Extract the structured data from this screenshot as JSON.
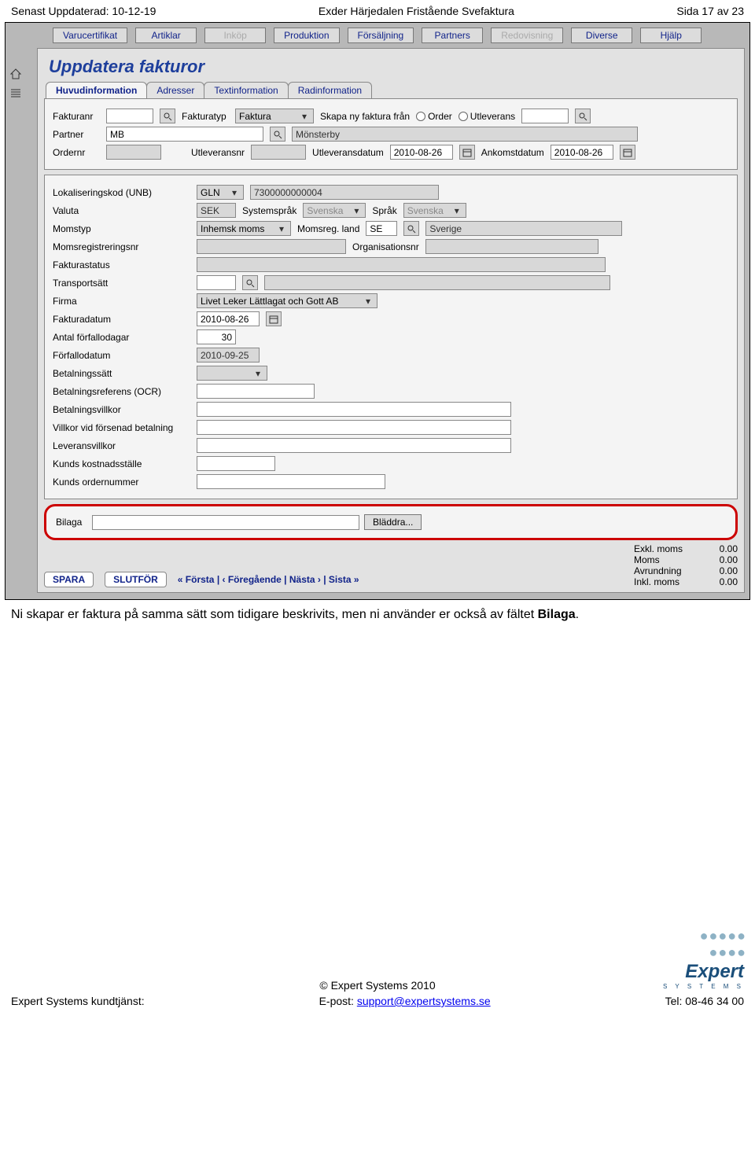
{
  "doc_header": {
    "updated_label": "Senast Uppdaterad: 10-12-19",
    "title": "Exder Härjedalen Fristående Svefaktura",
    "page": "Sida 17 av 23"
  },
  "menu": {
    "items": [
      "Varucertifikat",
      "Artiklar",
      "Inköp",
      "Produktion",
      "Försäljning",
      "Partners",
      "Redovisning",
      "Diverse",
      "Hjälp"
    ],
    "disabled": [
      2,
      6
    ]
  },
  "page_title": "Uppdatera fakturor",
  "tabs": [
    "Huvudinformation",
    "Adresser",
    "Textinformation",
    "Radinformation"
  ],
  "top": {
    "fakturanr_lbl": "Fakturanr",
    "fakturanr": "",
    "fakturatyp_lbl": "Fakturatyp",
    "fakturatyp": "Faktura",
    "ny_fran_lbl": "Skapa ny faktura från",
    "ny_opt1": "Order",
    "ny_opt2": "Utleverans",
    "ny_val": "",
    "partner_lbl": "Partner",
    "partner": "MB",
    "partner_name": "Mönsterby",
    "ordernr_lbl": "Ordernr",
    "ordernr": "",
    "utleveransnr_lbl": "Utleveransnr",
    "utleveransnr": "",
    "utleveransdatum_lbl": "Utleveransdatum",
    "utleveransdatum": "2010-08-26",
    "ankomstdatum_lbl": "Ankomstdatum",
    "ankomstdatum": "2010-08-26"
  },
  "main": {
    "lok_lbl": "Lokaliseringskod (UNB)",
    "lok_type": "GLN",
    "lok_val": "7300000000004",
    "valuta_lbl": "Valuta",
    "valuta": "SEK",
    "sysspr_lbl": "Systemspråk",
    "sysspr": "Svenska",
    "spr_lbl": "Språk",
    "spr": "Svenska",
    "momstyp_lbl": "Momstyp",
    "momstyp": "Inhemsk moms",
    "momsreg_land_lbl": "Momsreg. land",
    "momsreg_land": "SE",
    "momsreg_land_name": "Sverige",
    "momsregnr_lbl": "Momsregistreringsnr",
    "momsregnr": "",
    "orgnr_lbl": "Organisationsnr",
    "orgnr": "",
    "status_lbl": "Fakturastatus",
    "status": "",
    "transport_lbl": "Transportsätt",
    "transport": "",
    "firma_lbl": "Firma",
    "firma": "Livet Leker Lättlagat och Gott AB",
    "fakturadatum_lbl": "Fakturadatum",
    "fakturadatum": "2010-08-26",
    "antal_lbl": "Antal förfallodagar",
    "antal": "30",
    "forfall_lbl": "Förfallodatum",
    "forfall": "2010-09-25",
    "betsatt_lbl": "Betalningssätt",
    "betsatt": "",
    "ocr_lbl": "Betalningsreferens (OCR)",
    "ocr": "",
    "betvill_lbl": "Betalningsvillkor",
    "betvill": "",
    "forsenad_lbl": "Villkor vid försenad betalning",
    "forsenad": "",
    "levvill_lbl": "Leveransvillkor",
    "levvill": "",
    "kost_lbl": "Kunds kostnadsställe",
    "kost": "",
    "kundorder_lbl": "Kunds ordernummer",
    "kundorder": ""
  },
  "bilaga": {
    "lbl": "Bilaga",
    "val": "",
    "browse": "Bläddra..."
  },
  "totals": {
    "exkl_lbl": "Exkl. moms",
    "exkl": "0.00",
    "moms_lbl": "Moms",
    "moms": "0.00",
    "avr_lbl": "Avrundning",
    "avr": "0.00",
    "inkl_lbl": "Inkl. moms",
    "inkl": "0.00"
  },
  "actions": {
    "spara": "SPARA",
    "slutfor": "SLUTFÖR",
    "pager": "« Första  |  ‹ Föregående  |  Nästa ›  |  Sista »"
  },
  "caption_parts": {
    "p1": "Ni skapar er faktura på samma sätt som tidigare beskrivits, men ni använder er också av fältet ",
    "bold": "Bilaga",
    "p2": "."
  },
  "footer": {
    "copy": "© Expert Systems 2010",
    "left": "Expert Systems kundtjänst:",
    "mid_lbl": "E-post: ",
    "mid_link": "support@expertsystems.se",
    "right": "Tel: 08-46 34 00",
    "brand": "Expert",
    "brand_sub": "S Y S T E M S"
  }
}
